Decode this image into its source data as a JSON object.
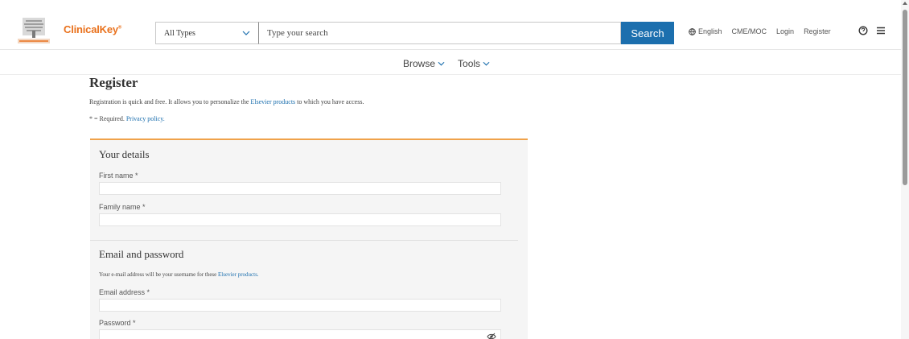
{
  "header": {
    "brand": "ClinicalKey",
    "brand_mark": "®",
    "type_select_value": "All Types",
    "search_placeholder": "Type your search",
    "search_button": "Search",
    "language": "English",
    "links": [
      "CME/MOC",
      "Login",
      "Register"
    ]
  },
  "nav": {
    "items": [
      "Browse",
      "Tools"
    ]
  },
  "page": {
    "title": "Register",
    "intro_before": "Registration is quick and free. It allows you to personalize the ",
    "intro_link": "Elsevier products",
    "intro_after": " to which you have access.",
    "required_text": "* = Required.",
    "privacy_link": "Privacy policy."
  },
  "form": {
    "details_title": "Your details",
    "first_name_label": "First name *",
    "family_name_label": "Family name *",
    "email_section_title": "Email and password",
    "email_note_before": "Your e-mail address will be your username for these ",
    "email_note_link": "Elsevier products.",
    "email_label": "Email address *",
    "password_label": "Password *"
  },
  "colors": {
    "brand_orange": "#e9711c",
    "search_blue": "#1c6fae",
    "accent_border": "#f0a24a"
  },
  "icons": {
    "logo": "elsevier-tree-icon",
    "globe": "globe-icon",
    "help": "help-icon",
    "menu": "menu-icon",
    "eye": "eye-slash-icon",
    "chevron": "chevron-down-icon"
  }
}
